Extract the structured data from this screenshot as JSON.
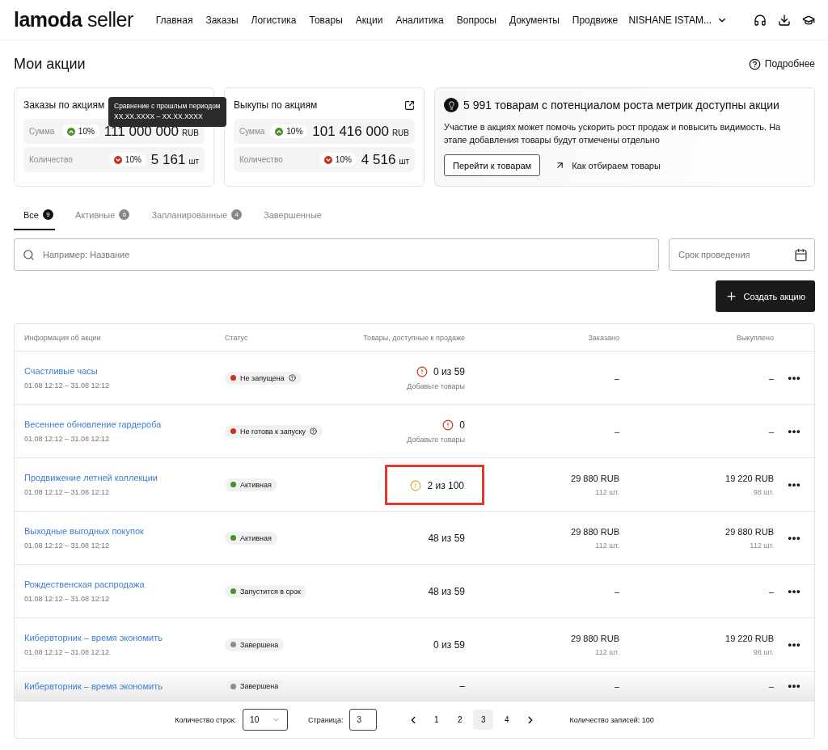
{
  "header": {
    "logo_brand": "lamoda",
    "logo_suffix": "seller",
    "nav": [
      {
        "label": "Главная"
      },
      {
        "label": "Заказы"
      },
      {
        "label": "Логистика"
      },
      {
        "label": "Товары"
      },
      {
        "label": "Акции"
      },
      {
        "label": "Аналитика"
      },
      {
        "label": "Вопросы"
      },
      {
        "label": "Документы"
      },
      {
        "label": "Продвиже"
      }
    ],
    "user": "NISHANE ISTAM..."
  },
  "page": {
    "title": "Мои акции",
    "help_link": "Подробнее"
  },
  "stat_cards": [
    {
      "title": "Заказы по акциям",
      "metrics": [
        {
          "label": "Сумма",
          "up": true,
          "change": "10%",
          "value": "111 000 000",
          "unit": "RUB"
        },
        {
          "label": "Количество",
          "up": false,
          "change": "10%",
          "value": "5 161",
          "unit": "шт"
        }
      ],
      "tooltip": {
        "title": "Сравнение с прошлым периодом",
        "period": "XX.XX.XXXX – XX.XX.XXXX"
      }
    },
    {
      "title": "Выкупы по акциям",
      "metrics": [
        {
          "label": "Сумма",
          "up": true,
          "change": "10%",
          "value": "101 416 000",
          "unit": "RUB"
        },
        {
          "label": "Количество",
          "up": false,
          "change": "10%",
          "value": "4 516",
          "unit": "шт"
        }
      ]
    }
  ],
  "promo_card": {
    "title": "5 991 товарам с потенциалом роста метрик доступны акции",
    "text": "Участие в акциях может помочь ускорить рост продаж и повысить видимость. На этапе добавления товары будут отмечены отдельно",
    "button": "Перейти к товарам",
    "link": "Как отбираем товары"
  },
  "tabs": [
    {
      "label": "Все",
      "count": "9",
      "selected": true
    },
    {
      "label": "Активные",
      "count": "6",
      "selected": false
    },
    {
      "label": "Запланированные",
      "count": "4",
      "selected": false
    },
    {
      "label": "Завершенные",
      "selected": false
    }
  ],
  "search": {
    "placeholder": "Например: Название"
  },
  "date_filter": {
    "placeholder": "Срок проведения"
  },
  "create_button": "Создать акцию",
  "table": {
    "columns": [
      "Информация об акции",
      "Статус",
      "Товары, доступные к продаже",
      "Заказано",
      "Выкуплено"
    ],
    "rows": [
      {
        "name": "Счастливые часы",
        "dates": "01.08 12:12 – 31.08 12:12",
        "status": {
          "label": "Не запущена",
          "color": "#c8321e",
          "help": true
        },
        "products": {
          "error": true,
          "warning": false,
          "value": "0 из 59",
          "hint": "Добавьте товары"
        },
        "ordered": {
          "value": "–"
        },
        "bought": {
          "value": "–"
        },
        "highlighted": false,
        "partial": false
      },
      {
        "name": "Весеннее обновление гардероба",
        "dates": "01.08 12:12 – 31.08 12:12",
        "status": {
          "label": "Не готова к запуску",
          "color": "#c8321e",
          "help": true
        },
        "products": {
          "error": true,
          "warning": false,
          "value": "0",
          "hint": "Добавьте товары"
        },
        "ordered": {
          "value": "–"
        },
        "bought": {
          "value": "–"
        },
        "highlighted": false,
        "partial": false
      },
      {
        "name": "Продвижение летней коллекции",
        "dates": "01.08 12:12 – 31.08 12:12",
        "status": {
          "label": "Активная",
          "color": "#4a8f2c",
          "help": false
        },
        "products": {
          "error": false,
          "warning": true,
          "value": "2 из 100"
        },
        "ordered": {
          "value": "29 880 RUB",
          "qty": "112 шт."
        },
        "bought": {
          "value": "19 220 RUB",
          "qty": "98 шт."
        },
        "highlighted": true,
        "partial": false
      },
      {
        "name": "Выходные выгодных покупок",
        "dates": "01.08 12:12 – 31.08 12:12",
        "status": {
          "label": "Активная",
          "color": "#4a8f2c",
          "help": false
        },
        "products": {
          "error": false,
          "warning": false,
          "value": "48 из 59"
        },
        "ordered": {
          "value": "29 880 RUB",
          "qty": "112 шт."
        },
        "bought": {
          "value": "29 880 RUB",
          "qty": "112 шт."
        },
        "highlighted": false,
        "partial": false
      },
      {
        "name": "Рождественская распродажа",
        "dates": "01.08 12:12 – 31.08 12:12",
        "status": {
          "label": "Запустится в срок",
          "color": "#4a8f2c",
          "help": false
        },
        "products": {
          "error": false,
          "warning": false,
          "value": "48 из 59"
        },
        "ordered": {
          "value": "–"
        },
        "bought": {
          "value": "–"
        },
        "highlighted": false,
        "partial": false
      },
      {
        "name": "Кибервторник – время экономить",
        "dates": "01.08 12:12 – 31.08 12:12",
        "status": {
          "label": "Завершена",
          "color": "#8c8c8c",
          "help": false
        },
        "products": {
          "error": false,
          "warning": false,
          "value": "0 из 59"
        },
        "ordered": {
          "value": "29 880 RUB",
          "qty": "112 шт."
        },
        "bought": {
          "value": "19 220 RUB",
          "qty": "98 шт."
        },
        "highlighted": false,
        "partial": false
      },
      {
        "name": "Кибервторник – время экономить",
        "status": {
          "label": "Завершена",
          "color": "#8c8c8c",
          "help": false
        },
        "products": {
          "error": false,
          "warning": false,
          "value": "–"
        },
        "ordered": {
          "value": "–"
        },
        "bought": {
          "value": "–"
        },
        "highlighted": false,
        "partial": true
      }
    ]
  },
  "pagination": {
    "rows_label": "Количество строк:",
    "rows_value": "10",
    "page_label": "Страница:",
    "page_value": "3",
    "pages": [
      {
        "label": "1",
        "selected": false
      },
      {
        "label": "2",
        "selected": false
      },
      {
        "label": "3",
        "selected": true
      },
      {
        "label": "4",
        "selected": false
      }
    ],
    "total": "Количество записей: 100"
  }
}
